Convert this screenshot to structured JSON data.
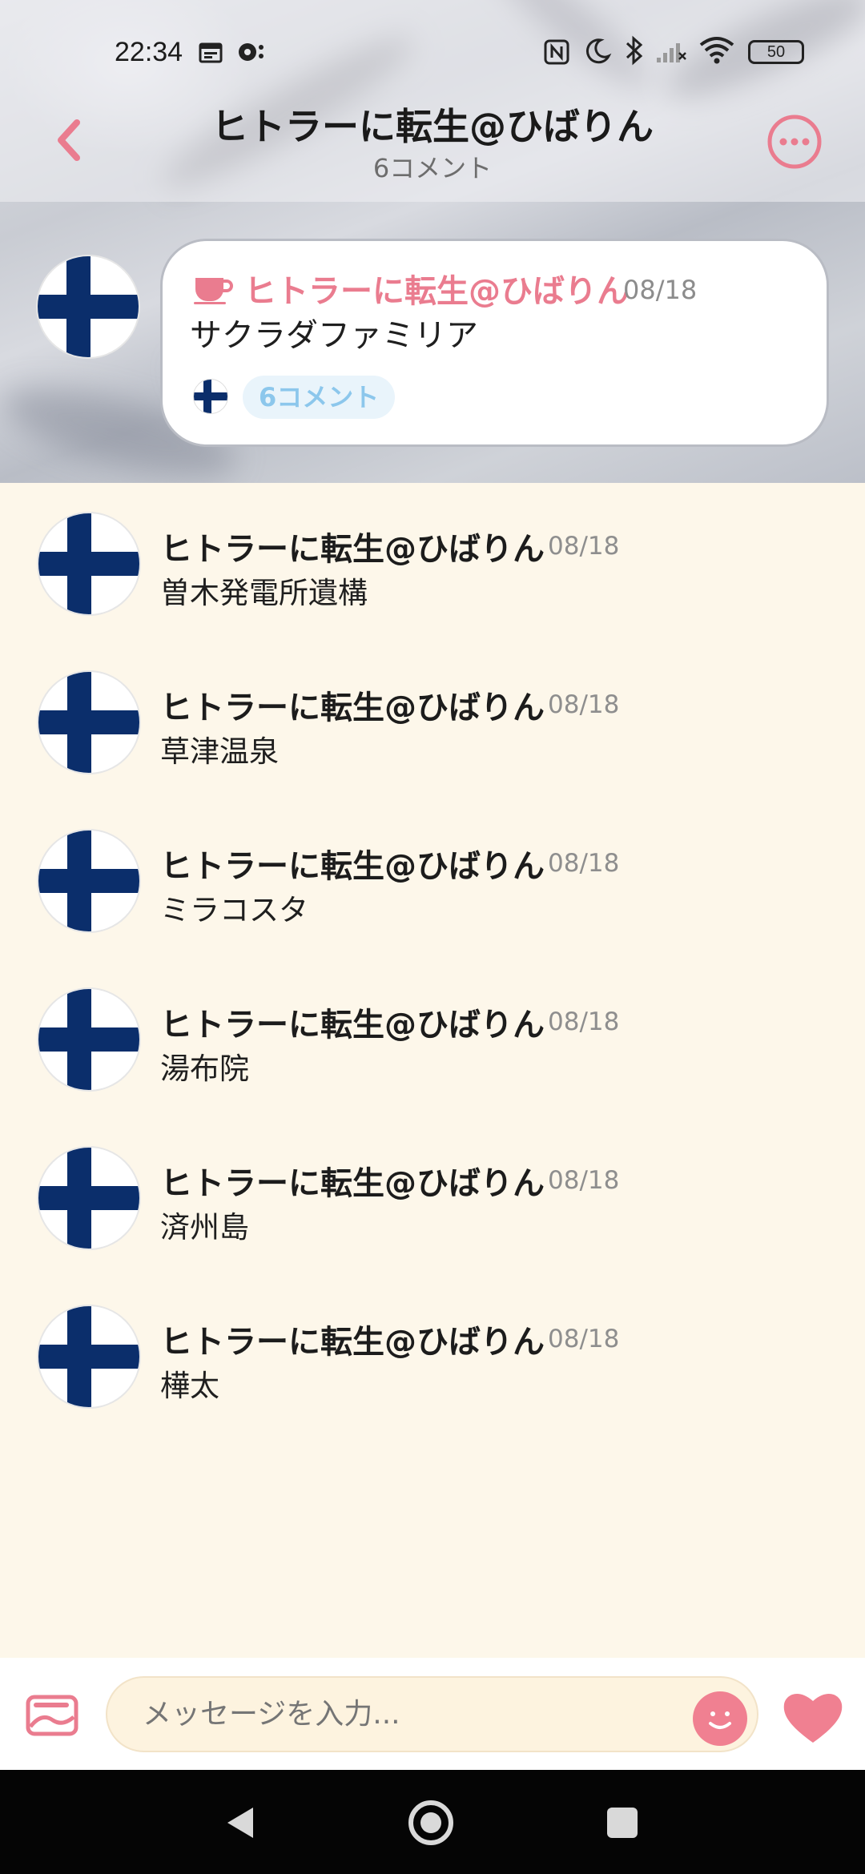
{
  "status_bar": {
    "time": "22:34",
    "battery": "50"
  },
  "header": {
    "title": "ヒトラーに転生@ひばりん",
    "subtitle": "6コメント"
  },
  "post": {
    "author": "ヒトラーに転生@ひばりん",
    "date": "08/18",
    "text": "サクラダファミリア",
    "comment_count": "6コメント"
  },
  "comments": [
    {
      "author": "ヒトラーに転生@ひばりん",
      "date": "08/18",
      "text": "曽木発電所遺構"
    },
    {
      "author": "ヒトラーに転生@ひばりん",
      "date": "08/18",
      "text": "草津温泉"
    },
    {
      "author": "ヒトラーに転生@ひばりん",
      "date": "08/18",
      "text": "ミラコスタ"
    },
    {
      "author": "ヒトラーに転生@ひばりん",
      "date": "08/18",
      "text": "湯布院"
    },
    {
      "author": "ヒトラーに転生@ひばりん",
      "date": "08/18",
      "text": "済州島"
    },
    {
      "author": "ヒトラーに転生@ひばりん",
      "date": "08/18",
      "text": "樺太"
    }
  ],
  "input": {
    "placeholder": "メッセージを入力..."
  },
  "colors": {
    "accent_pink": "#ea7c8f",
    "background": "#fdf7ea",
    "flag_blue": "#0b2e6b",
    "pill_blue": "#8cc7ec"
  },
  "icons": {
    "back": "chevron-left-icon",
    "more": "more-dots-icon",
    "post_type": "cup-icon",
    "image": "image-icon",
    "emoji": "smiley-icon",
    "like": "heart-icon"
  }
}
